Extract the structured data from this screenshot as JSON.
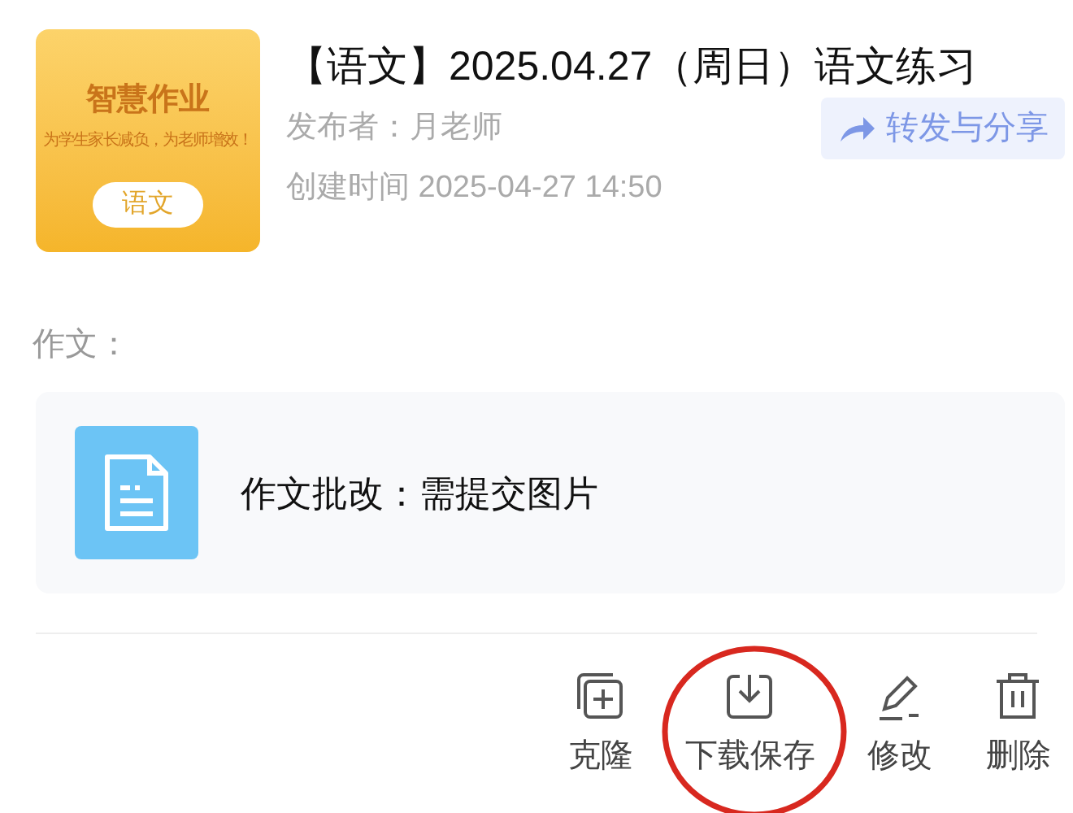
{
  "thumbnail": {
    "title": "智慧作业",
    "slogan": "为学生家长减负，为老师增效！",
    "subject": "语文"
  },
  "title": "【语文】2025.04.27（周日）语文练习",
  "publisher": "发布者：月老师",
  "share_button": {
    "label": "转发与分享"
  },
  "created": "创建时间 2025-04-27 14:50",
  "section_label": "作文：",
  "attachment": {
    "label": "作文批改：需提交图片"
  },
  "actions": [
    {
      "kind": "clone",
      "label": "克隆",
      "highlighted": false
    },
    {
      "kind": "download",
      "label": "下载保存",
      "highlighted": true
    },
    {
      "kind": "edit",
      "label": "修改",
      "highlighted": false
    },
    {
      "kind": "delete",
      "label": "删除",
      "highlighted": false
    }
  ]
}
